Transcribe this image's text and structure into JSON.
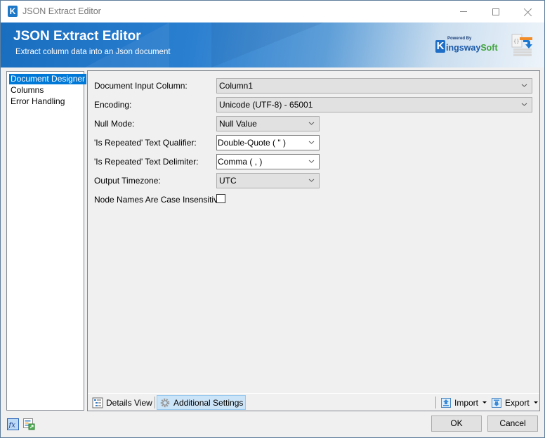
{
  "window": {
    "title": "JSON Extract Editor",
    "controls": {
      "minimize": "minimize",
      "maximize": "maximize",
      "close": "close"
    }
  },
  "banner": {
    "title": "JSON Extract Editor",
    "subtitle": "Extract column data into an Json document",
    "logo": {
      "powered_by": "Powered By",
      "k": "K",
      "brand_main": "ingsway",
      "brand_accent": "Soft"
    }
  },
  "nav": {
    "items": [
      {
        "label": "Document Designer",
        "selected": true
      },
      {
        "label": "Columns",
        "selected": false
      },
      {
        "label": "Error Handling",
        "selected": false
      }
    ]
  },
  "form": {
    "fields": [
      {
        "label": "Document Input Column:",
        "value": "Column1"
      },
      {
        "label": "Encoding:",
        "value": "Unicode (UTF-8) - 65001"
      },
      {
        "label": "Null Mode:",
        "value": "Null Value"
      },
      {
        "label": "'Is Repeated' Text Qualifier:",
        "value": "Double-Quote ( \" )"
      },
      {
        "label": "'Is Repeated' Text Delimiter:",
        "value": "Comma ( , )"
      },
      {
        "label": "Output Timezone:",
        "value": "UTC"
      }
    ],
    "checkbox": {
      "label": "Node Names Are Case Insensitive:",
      "checked": false
    }
  },
  "toolbar": {
    "details_view": "Details View",
    "additional_settings": "Additional Settings",
    "import": "Import",
    "export": "Export"
  },
  "footer": {
    "ok": "OK",
    "cancel": "Cancel"
  },
  "colors": {
    "accent": "#0078d7",
    "banner": "#1a6ec0",
    "brand_green": "#3fa33a"
  }
}
